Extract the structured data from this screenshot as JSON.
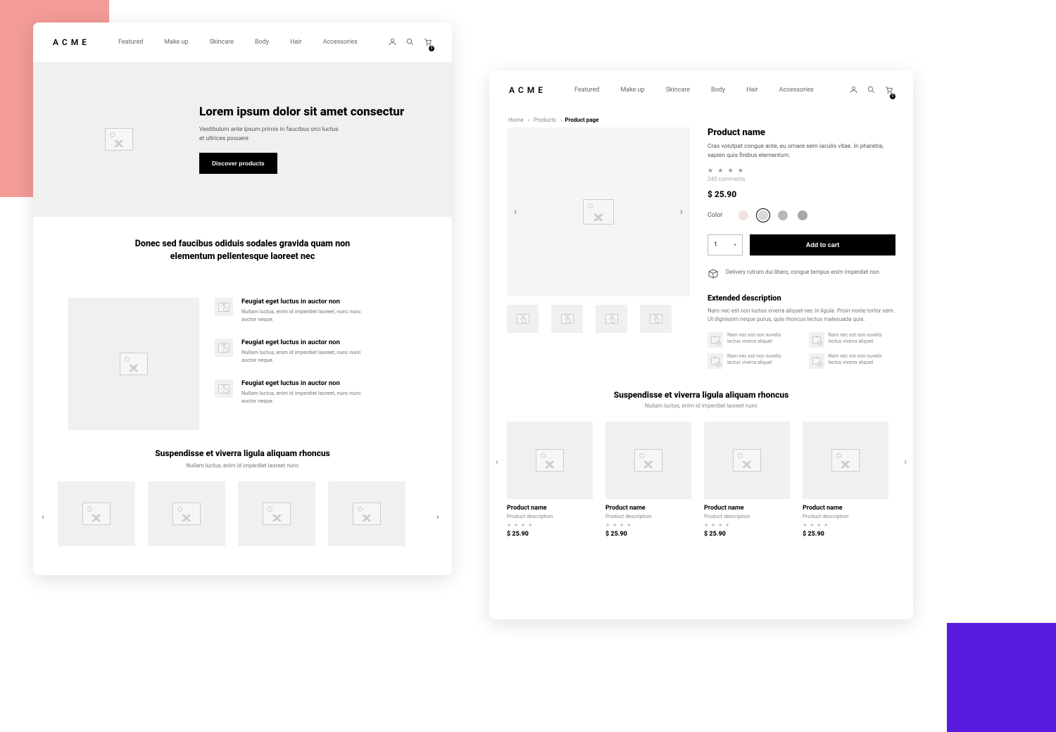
{
  "brand": "ACME",
  "nav": [
    "Featured",
    "Make up",
    "Skincare",
    "Body",
    "Hair",
    "Accessories"
  ],
  "cart_count": "0",
  "left_page": {
    "hero": {
      "title": "Lorem ipsum dolor sit amet consectur",
      "body": "Vestibulum ante ipsum primis in faucibus orci luctus et ultrices posuere",
      "cta": "Discover  products"
    },
    "intro_heading": "Donec sed faucibus odiduis sodales gravida quam non elementum pellentesque laoreet nec",
    "features": [
      {
        "title": "Feugiat eget luctus in auctor non",
        "body": "Nullam luctus, enim id imperdiet laoreet, nunc nunc auctor neque."
      },
      {
        "title": "Feugiat eget luctus in auctor non",
        "body": "Nullam luctus, enim id imperdiet laoreet, nunc nunc auctor neque."
      },
      {
        "title": "Feugiat eget luctus in auctor non",
        "body": "Nullam luctus, enim id imperdiet laoreet, nunc nunc auctor neque."
      }
    ],
    "carousel": {
      "title": "Suspendisse et viverra ligula aliquam rhoncus",
      "sub": "Nullam luctus, enim id imperdiet laoreet nunc"
    }
  },
  "right_page": {
    "crumbs": [
      "Home",
      "Products",
      "Product page"
    ],
    "product": {
      "name": "Product name",
      "desc": "Cras volutpat congue ante, eu ornare sem iaculis vitae. In pharetra, sapien quis finibus elementum.",
      "rating": "★ ★ ★ ★",
      "comments": "240 comments",
      "price": "$ 25.90",
      "color_label": "Color",
      "swatches": [
        "#f0e4de",
        "#d9d9d9",
        "#b8b8b8",
        "#a8a8a8"
      ],
      "swatch_selected": 1,
      "qty": "1",
      "add_cart": "Add to cart",
      "delivery": "Delivery rutrum dui libero, congue tempus enim imperdiet non",
      "ext_title": "Extended description",
      "ext_body": "Nam nec est non luctus viverra aliquet nec in ligula. Proin nonte tortor sem. Ut dignissim neque purus, quis rhoncus lectus malesuada quis.",
      "ext_items": [
        "Nam nec est non nuvelis lectus viverra aliquet",
        "Nam nec est non nuvelis lectus viverra aliquet",
        "Nam nec est non nuvelis lectus viverra aliquet",
        "Nam nec est non nuvelis lectus viverra aliquet"
      ]
    },
    "related": {
      "title": "Suspendisse et viverra ligula aliquam rhoncus",
      "sub": "Nullam luctus, enim id imperdiet laoreet nunc",
      "items": [
        {
          "name": "Product name",
          "desc": "Product description",
          "stars": "★ ★ ★ ★",
          "price": "$ 25.90"
        },
        {
          "name": "Product name",
          "desc": "Product description",
          "stars": "★ ★ ★ ★",
          "price": "$ 25.90"
        },
        {
          "name": "Product name",
          "desc": "Product description",
          "stars": "★ ★ ★ ★",
          "price": "$ 25.90"
        },
        {
          "name": "Product name",
          "desc": "Product description",
          "stars": "★ ★ ★ ★",
          "price": "$ 25.90"
        }
      ]
    }
  }
}
